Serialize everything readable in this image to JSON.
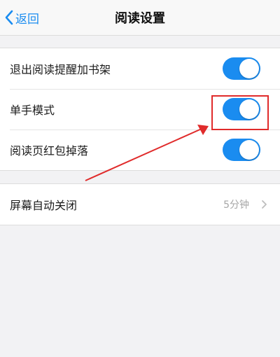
{
  "nav": {
    "back_label": "返回",
    "title": "阅读设置"
  },
  "settings": {
    "toggles": [
      {
        "label": "退出阅读提醒加书架",
        "on": true
      },
      {
        "label": "单手模式",
        "on": true
      },
      {
        "label": "阅读页红包掉落",
        "on": true
      }
    ],
    "screen_off": {
      "label": "屏幕自动关闭",
      "value": "5分钟"
    }
  },
  "colors": {
    "accent": "#1a8cf0",
    "annotation": "#e02b2b",
    "background": "#f2f2f4"
  },
  "icons": {
    "back": "chevron-left-icon",
    "disclosure": "chevron-right-icon"
  }
}
